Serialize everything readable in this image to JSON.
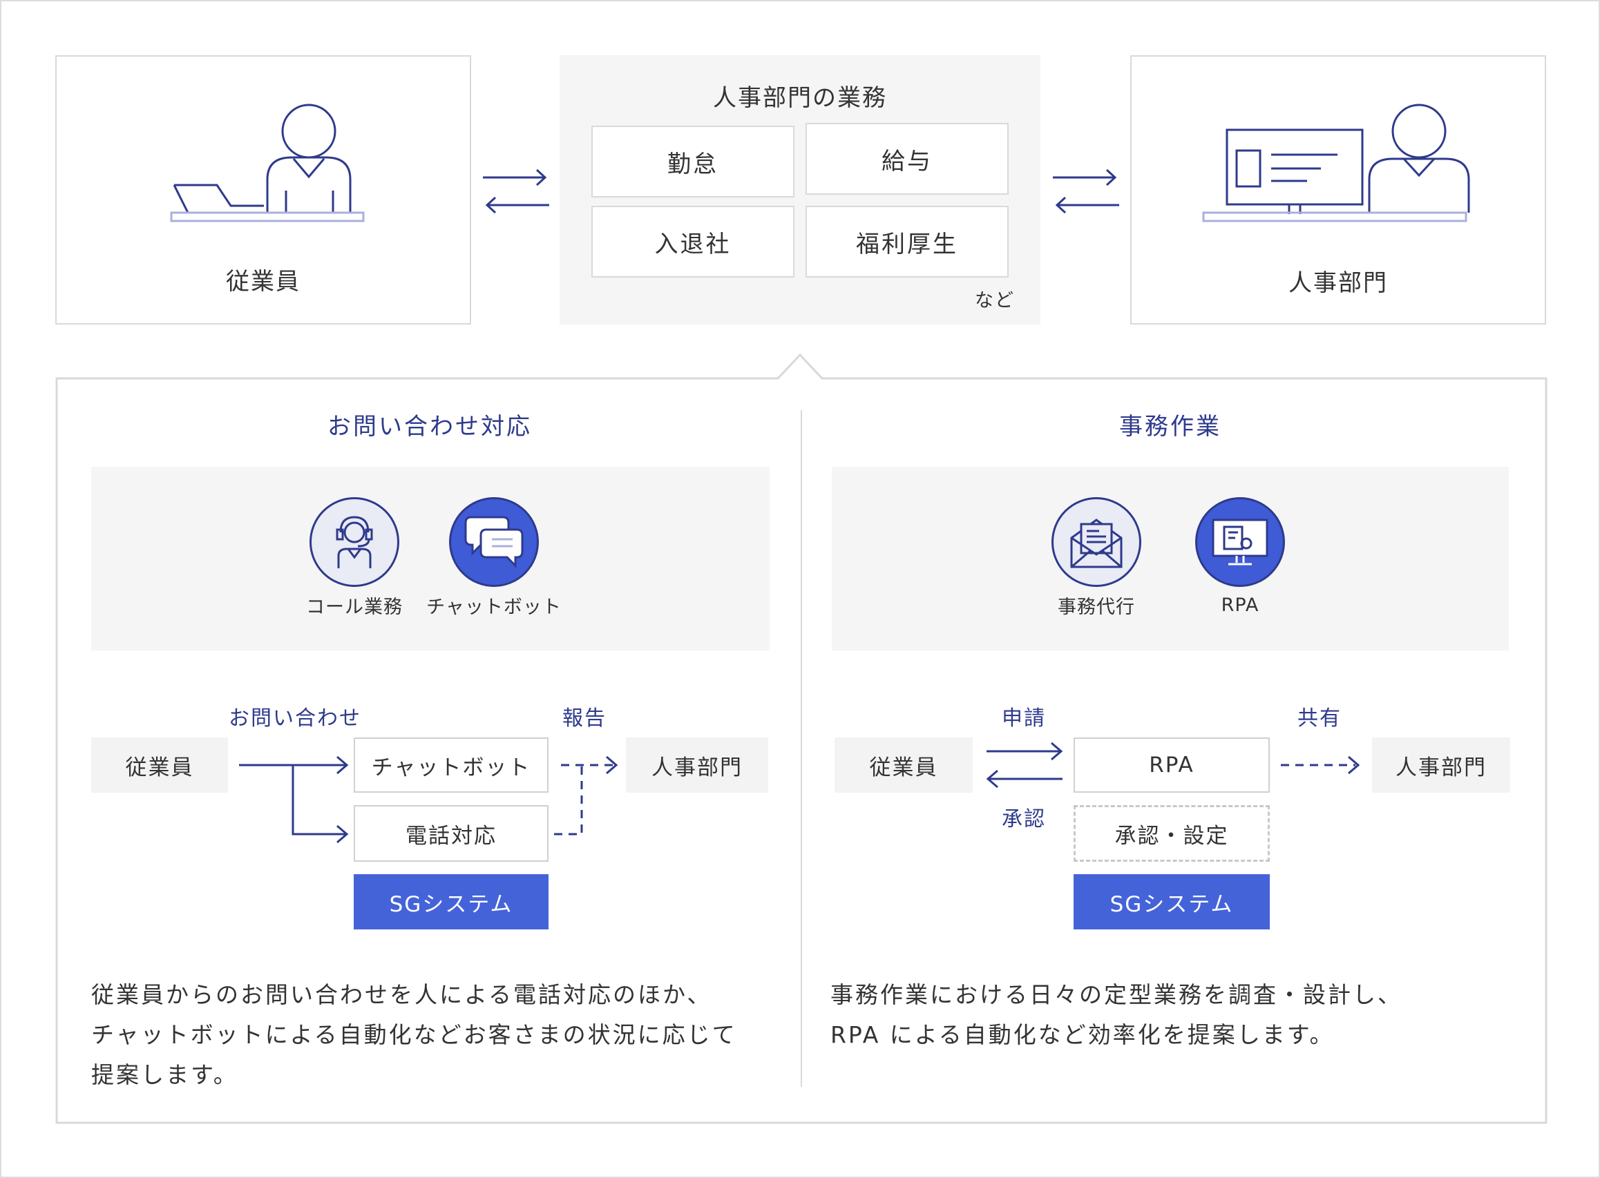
{
  "top": {
    "employee_label": "従業員",
    "hr_dept_label": "人事部門",
    "hr_work": {
      "title": "人事部門の業務",
      "tasks": [
        "勤怠",
        "給与",
        "入退社",
        "福利厚生"
      ],
      "note": "など"
    }
  },
  "left_section": {
    "title": "お問い合わせ対応",
    "services": [
      {
        "label": "コール業務",
        "icon": "headset-operator-icon"
      },
      {
        "label": "チャットボット",
        "icon": "chat-bubbles-icon"
      }
    ],
    "flow": {
      "inquiry_label": "お問い合わせ",
      "report_label": "報告",
      "from": "従業員",
      "to": "人事部門",
      "nodes": [
        "チャットボット",
        "電話対応"
      ],
      "system": "SGシステム"
    },
    "description": [
      "従業員からのお問い合わせを人による電話対応のほか、",
      "チャットボットによる自動化などお客さまの状況に応じて",
      "提案します。"
    ]
  },
  "right_section": {
    "title": "事務作業",
    "services": [
      {
        "label": "事務代行",
        "icon": "envelope-document-icon"
      },
      {
        "label": "RPA",
        "icon": "monitor-rpa-icon"
      }
    ],
    "flow": {
      "apply_label": "申請",
      "approve_label": "承認",
      "share_label": "共有",
      "from": "従業員",
      "to": "人事部門",
      "nodes": [
        "RPA",
        "承認・設定"
      ],
      "system": "SGシステム"
    },
    "description": [
      "事務作業における日々の定型業務を調査・設計し、",
      "RPA による自動化など効率化を提案します。"
    ]
  },
  "colors": {
    "navy": "#2e3a8c",
    "blue": "#4563d9",
    "gray_bg": "#f5f5f5",
    "border": "#d9d9d9"
  }
}
